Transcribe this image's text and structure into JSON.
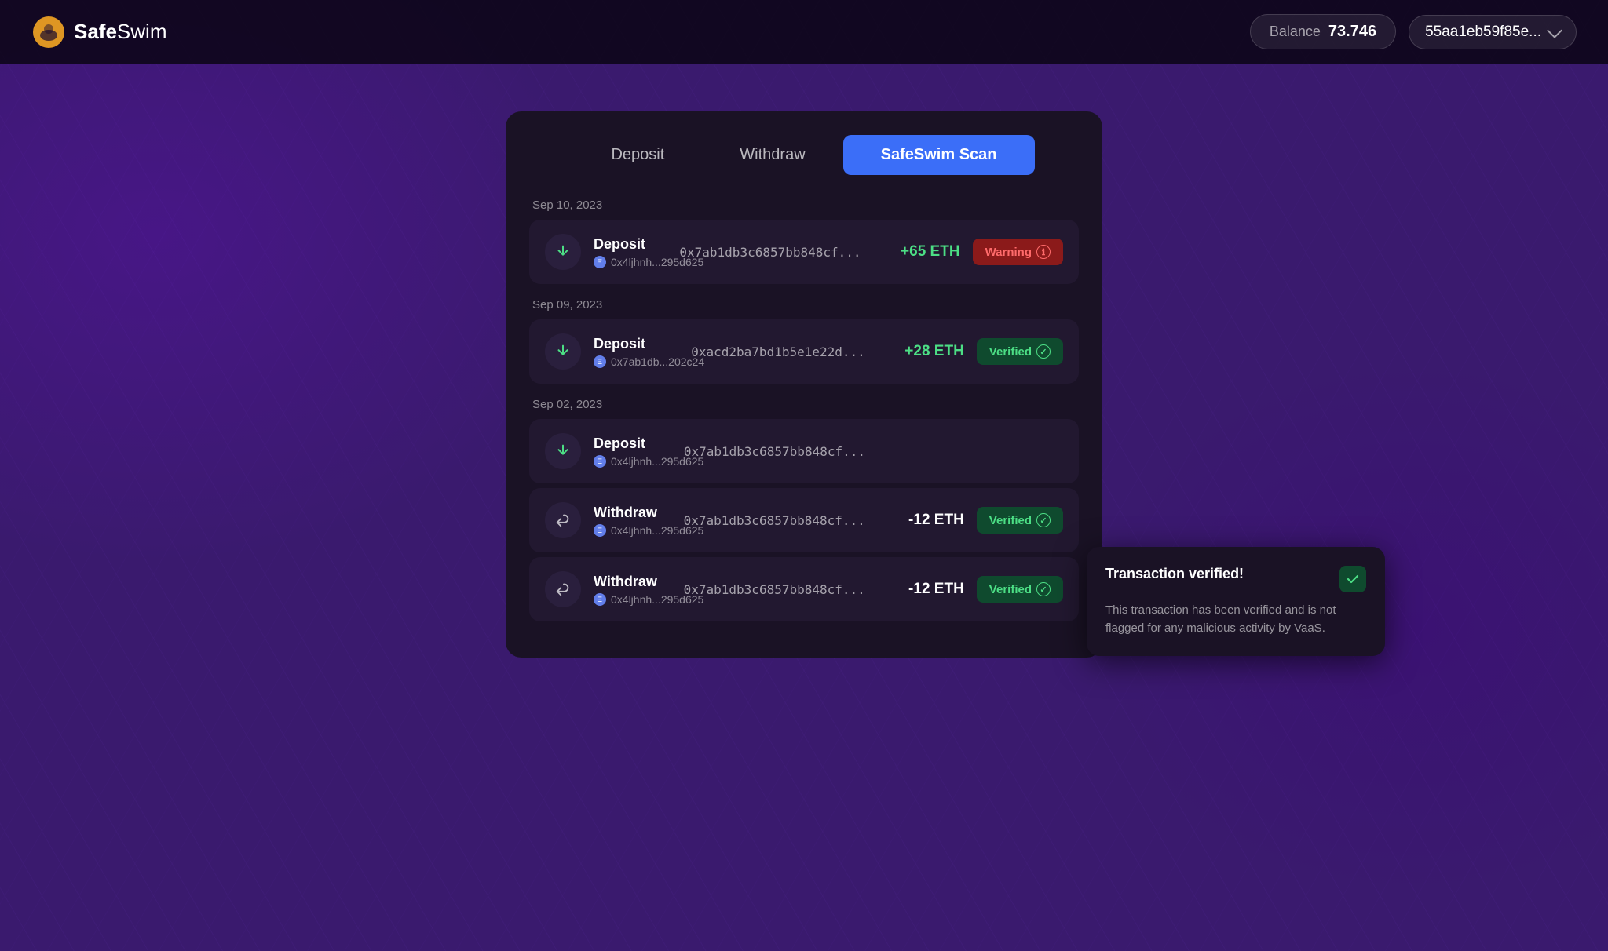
{
  "header": {
    "logo_text_bold": "Safe",
    "logo_text_light": "Swim",
    "balance_label": "Balance",
    "balance_amount": "73.746",
    "wallet_address": "55aa1eb59f85e...",
    "chevron_icon": "chevron-down"
  },
  "tabs": [
    {
      "id": "deposit",
      "label": "Deposit",
      "active": false
    },
    {
      "id": "withdraw",
      "label": "Withdraw",
      "active": false
    },
    {
      "id": "safeswim-scan",
      "label": "SafeSwim Scan",
      "active": true
    }
  ],
  "sections": [
    {
      "date": "Sep 10, 2023",
      "transactions": [
        {
          "type": "Deposit",
          "direction": "in",
          "from_address": "0x4ljhnh...295d625",
          "tx_hash": "0x7ab1db3c6857bb848cf...",
          "amount": "+65 ETH",
          "amount_type": "positive",
          "status": "warning",
          "status_label": "Warning"
        }
      ]
    },
    {
      "date": "Sep 09, 2023",
      "transactions": [
        {
          "type": "Deposit",
          "direction": "in",
          "from_address": "0x7ab1db...202c24",
          "tx_hash": "0xacd2ba7bd1b5e1e22d...",
          "amount": "+28 ETH",
          "amount_type": "positive",
          "status": "verified",
          "status_label": "Verified"
        }
      ]
    },
    {
      "date": "Sep 02, 2023",
      "transactions": [
        {
          "type": "Deposit",
          "direction": "in",
          "from_address": "0x4ljhnh...295d625",
          "tx_hash": "0x7ab1db3c6857bb848cf...",
          "amount": "",
          "amount_type": "",
          "status": "none",
          "status_label": ""
        },
        {
          "type": "Withdraw",
          "direction": "out",
          "from_address": "0x4ljhnh...295d625",
          "tx_hash": "0x7ab1db3c6857bb848cf...",
          "amount": "-12 ETH",
          "amount_type": "negative",
          "status": "verified",
          "status_label": "Verified"
        },
        {
          "type": "Withdraw",
          "direction": "out",
          "from_address": "0x4ljhnh...295d625",
          "tx_hash": "0x7ab1db3c6857bb848cf...",
          "amount": "-12 ETH",
          "amount_type": "negative",
          "status": "verified",
          "status_label": "Verified"
        }
      ]
    }
  ],
  "tooltip": {
    "title": "Transaction verified!",
    "body": "This transaction has been verified and is not flagged for any malicious activity by VaaS."
  }
}
